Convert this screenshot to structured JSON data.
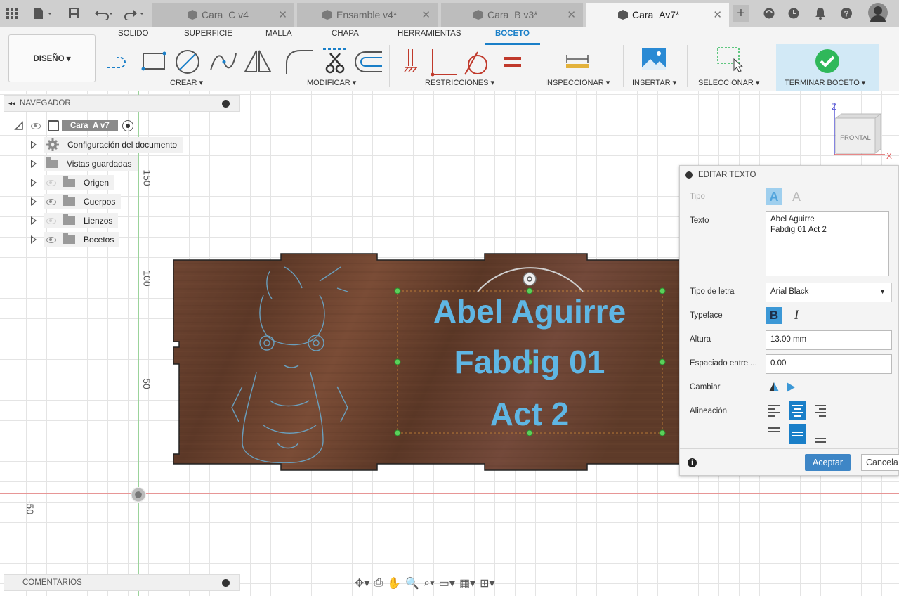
{
  "window": {
    "tabs": [
      {
        "label": "Cara_C v4"
      },
      {
        "label": "Ensamble v4*"
      },
      {
        "label": "Cara_B v3*"
      },
      {
        "label": "Cara_Av7*"
      }
    ],
    "active_tab": 3
  },
  "ribbon": {
    "tabs": [
      "SOLIDO",
      "SUPERFICIE",
      "MALLA",
      "CHAPA",
      "HERRAMIENTAS",
      "BOCETO"
    ],
    "active_tab": "BOCETO",
    "design_label": "DISEÑO ▾",
    "groups": {
      "crear": "CREAR ▾",
      "modificar": "MODIFICAR ▾",
      "restricciones": "RESTRICCIONES ▾",
      "inspeccionar": "INSPECCIONAR ▾",
      "insertar": "INSERTAR ▾",
      "seleccionar": "SELECCIONAR ▾",
      "terminar": "TERMINAR BOCETO ▾"
    }
  },
  "navigator": {
    "title": "NAVEGADOR",
    "root": "Cara_A v7",
    "items": [
      {
        "label": "Configuración del documento",
        "icon": "gear-icon",
        "eye": "none"
      },
      {
        "label": "Vistas guardadas",
        "icon": "folder-icon",
        "eye": "none"
      },
      {
        "label": "Origen",
        "icon": "folder-icon",
        "eye": "hidden"
      },
      {
        "label": "Cuerpos",
        "icon": "folder-icon",
        "eye": "visible"
      },
      {
        "label": "Lienzos",
        "icon": "folder-icon",
        "eye": "hidden"
      },
      {
        "label": "Bocetos",
        "icon": "folder-icon",
        "eye": "visible"
      }
    ]
  },
  "canvas": {
    "axis_labels": [
      "150",
      "100",
      "50",
      "-50"
    ],
    "text_lines": [
      "Abel Aguirre",
      "Fabdig 01",
      "Act 2"
    ],
    "text_color": "#5fb6e4",
    "board_color": "#6b4330"
  },
  "viewcube": {
    "face": "FRONTAL",
    "z": "Z",
    "x": "X"
  },
  "comments": {
    "title": "COMENTARIOS"
  },
  "edit_text": {
    "title": "EDITAR TEXTO",
    "tipo_label": "Tipo",
    "texto_label": "Texto",
    "texto_lines": [
      "Abel Aguirre",
      "Fabdig 01 Act 2"
    ],
    "font_label": "Tipo de letra",
    "font_value": "Arial Black",
    "typeface_label": "Typeface",
    "bold": "B",
    "italic": "I",
    "altura_label": "Altura",
    "altura_value": "13.00 mm",
    "espaciado_label": "Espaciado entre ...",
    "espaciado_value": "0.00",
    "cambiar_label": "Cambiar",
    "alineacion_label": "Alineación",
    "accept": "Aceptar",
    "cancel": "Cancela"
  },
  "colors": {
    "accent": "#1a7fc8",
    "finish": "#2fb85a"
  }
}
